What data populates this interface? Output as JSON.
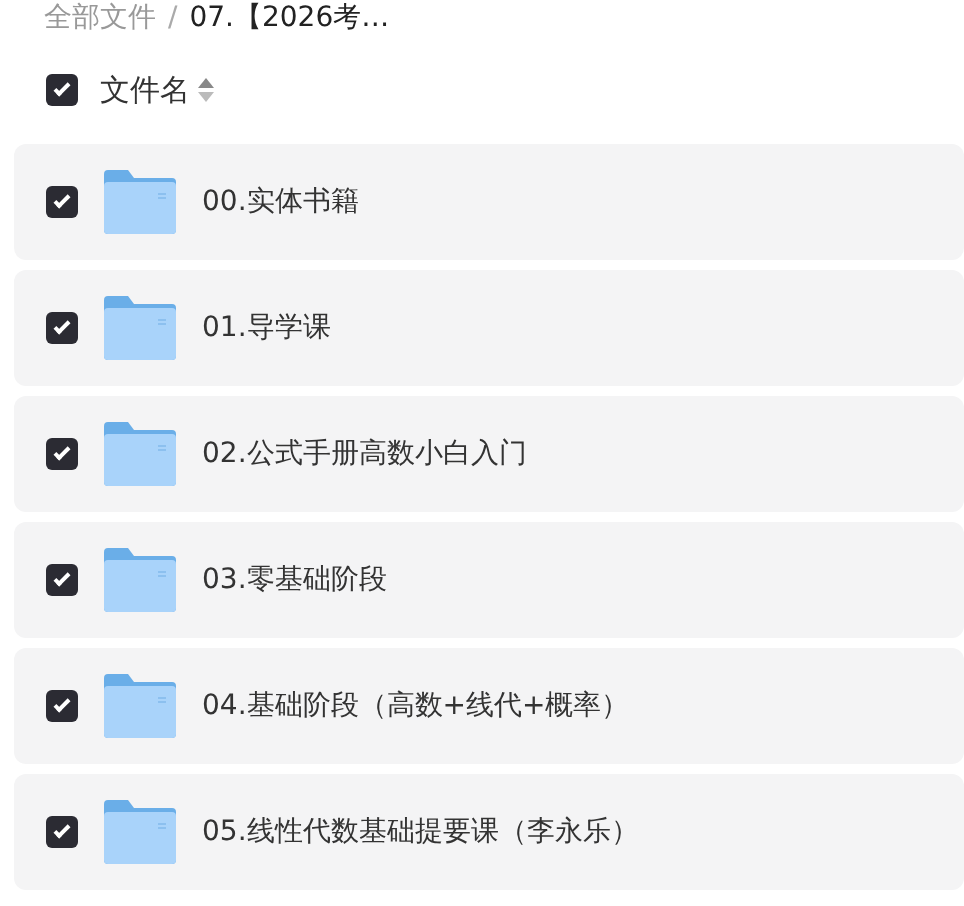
{
  "breadcrumb": {
    "root": "全部文件",
    "separator": "/",
    "current": "07.【2026考…"
  },
  "header": {
    "checked": true,
    "label": "文件名"
  },
  "files": [
    {
      "name": "00.实体书籍",
      "checked": true
    },
    {
      "name": "01.导学课",
      "checked": true
    },
    {
      "name": "02.公式手册高数小白入门",
      "checked": true
    },
    {
      "name": "03.零基础阶段",
      "checked": true
    },
    {
      "name": "04.基础阶段（高数+线代+概率）",
      "checked": true
    },
    {
      "name": "05.线性代数基础提要课（李永乐）",
      "checked": true
    }
  ]
}
